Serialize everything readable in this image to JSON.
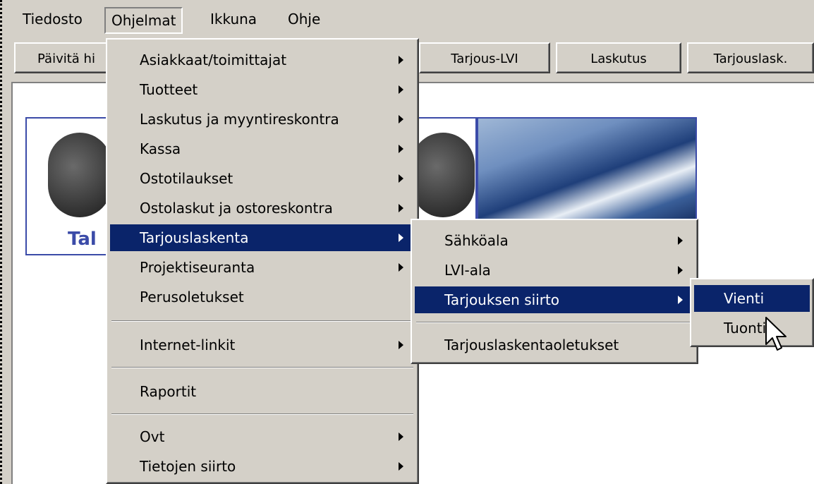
{
  "menubar": {
    "items": [
      "Tiedosto",
      "Ohjelmat",
      "Ikkuna",
      "Ohje"
    ]
  },
  "toolbar": {
    "buttons": [
      "Päivitä hi",
      "Tarjous-LVI",
      "Laskutus",
      "Tarjouslask."
    ]
  },
  "logo": {
    "text": "Tal"
  },
  "ohjelmat_menu": {
    "items": [
      "Asiakkaat/toimittajat",
      "Tuotteet",
      "Laskutus ja myyntireskontra",
      "Kassa",
      "Ostotilaukset",
      "Ostolaskut ja ostoreskontra",
      "Tarjouslaskenta",
      "Projektiseuranta",
      "Perusoletukset",
      "Internet-linkit",
      "Raportit",
      "Ovt",
      "Tietojen siirto"
    ]
  },
  "tarjouslaskenta_menu": {
    "items": [
      "Sähköala",
      "LVI-ala",
      "Tarjouksen siirto",
      "Tarjouslaskentaoletukset"
    ]
  },
  "siirto_menu": {
    "items": [
      "Vienti",
      "Tuonti"
    ]
  },
  "colors": {
    "menu_bg": "#d4d0c8",
    "highlight": "#0a246a",
    "logo_blue": "#3b4ba8"
  }
}
